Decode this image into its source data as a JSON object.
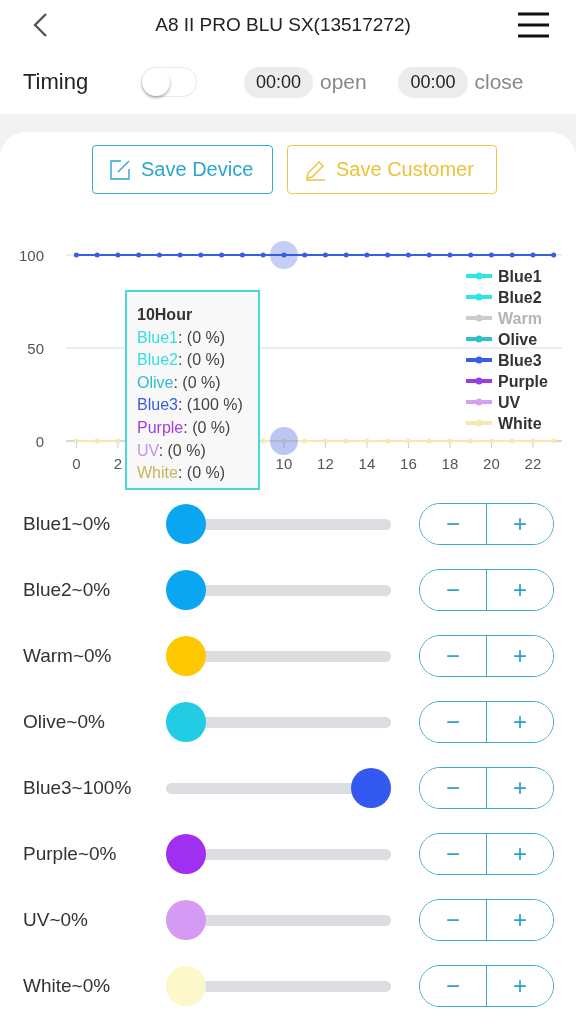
{
  "header": {
    "title": "A8 II PRO BLU SX(13517272)"
  },
  "timing": {
    "label": "Timing",
    "on": false,
    "open_time": "00:00",
    "open_label": "open",
    "close_time": "00:00",
    "close_label": "close"
  },
  "buttons": [
    {
      "kind": "device",
      "label": "Save Device"
    },
    {
      "kind": "customer",
      "label": "Save Customer"
    }
  ],
  "chart": {
    "chart_data": {
      "type": "line",
      "x": [
        0,
        1,
        2,
        3,
        4,
        5,
        6,
        7,
        8,
        9,
        10,
        11,
        12,
        13,
        14,
        15,
        16,
        17,
        18,
        19,
        20,
        21,
        22,
        23
      ],
      "xlim": [
        -0.5,
        23.4
      ],
      "xticks": [
        0,
        2,
        10,
        12,
        14,
        16,
        18,
        20,
        22
      ],
      "yticks": [
        0,
        50,
        100
      ],
      "ylim": [
        0,
        100
      ],
      "legend": "right",
      "series": [
        {
          "name": "Blue1",
          "color": "#2ee6e6",
          "values": [
            null,
            null,
            null,
            null,
            null,
            null,
            null,
            null,
            null,
            null,
            null,
            null,
            null,
            null,
            null,
            null,
            null,
            null,
            null,
            null,
            null,
            null,
            null,
            null
          ]
        },
        {
          "name": "Blue2",
          "color": "#2ee6e6",
          "values": [
            null,
            null,
            null,
            null,
            null,
            null,
            null,
            null,
            null,
            null,
            null,
            null,
            null,
            null,
            null,
            null,
            null,
            null,
            null,
            null,
            null,
            null,
            null,
            null
          ]
        },
        {
          "name": "Warm",
          "color": "#cccccc",
          "values": [
            null,
            null,
            null,
            null,
            null,
            null,
            null,
            null,
            null,
            null,
            null,
            null,
            null,
            null,
            null,
            null,
            null,
            null,
            null,
            null,
            null,
            null,
            null,
            null
          ]
        },
        {
          "name": "Olive",
          "color": "#2fc0d0",
          "values": [
            null,
            null,
            null,
            null,
            null,
            null,
            null,
            null,
            null,
            null,
            null,
            null,
            null,
            null,
            null,
            null,
            null,
            null,
            null,
            null,
            null,
            null,
            null,
            null
          ]
        },
        {
          "name": "Blue3",
          "color": "#3a5ee0",
          "values": [
            100,
            100,
            100,
            100,
            100,
            100,
            100,
            100,
            100,
            100,
            100,
            100,
            100,
            100,
            100,
            100,
            100,
            100,
            100,
            100,
            100,
            100,
            100,
            100
          ]
        },
        {
          "name": "Purple",
          "color": "#9b3ee0",
          "values": [
            null,
            null,
            null,
            null,
            null,
            null,
            null,
            null,
            null,
            null,
            null,
            null,
            null,
            null,
            null,
            null,
            null,
            null,
            null,
            null,
            null,
            null,
            null,
            null
          ]
        },
        {
          "name": "UV",
          "color": "#d4a0f0",
          "values": [
            null,
            null,
            null,
            null,
            null,
            null,
            null,
            null,
            null,
            null,
            null,
            null,
            null,
            null,
            null,
            null,
            null,
            null,
            null,
            null,
            null,
            null,
            null,
            null
          ]
        },
        {
          "name": "White",
          "color": "#f3e9b4",
          "values": [
            0,
            0,
            0,
            null,
            null,
            null,
            null,
            null,
            null,
            0,
            0,
            0,
            0,
            0,
            0,
            0,
            0,
            0,
            0,
            0,
            0,
            0,
            0,
            0
          ]
        }
      ]
    },
    "legend": [
      {
        "on": true
      },
      {
        "on": true
      },
      {
        "on": false
      },
      {
        "on": true
      },
      {
        "on": true
      },
      {
        "on": true
      },
      {
        "on": true
      },
      {
        "on": true
      }
    ],
    "tooltip": {
      "title": "10Hour",
      "entries": [
        {
          "name": "Blue1",
          "color": "#33dede",
          "value": ": (0 %)"
        },
        {
          "name": "Blue2",
          "color": "#33dede",
          "value": ": (0 %)"
        },
        {
          "name": "Olive",
          "color": "#30bccc",
          "value": ": (0 %)"
        },
        {
          "name": "Blue3",
          "color": "#3a5ed8",
          "value": ": (100 %)"
        },
        {
          "name": "Purple",
          "color": "#a040e0",
          "value": ": (0 %)"
        },
        {
          "name": "UV",
          "color": "#c690ec",
          "value": ": (0 %)"
        },
        {
          "name": "White",
          "color": "#c8b560",
          "value": ": (0 %)"
        }
      ]
    }
  },
  "channels": [
    {
      "label": "Blue1~0%",
      "level": 0,
      "color": "#0aa6f2",
      "minus": "−",
      "plus": "+"
    },
    {
      "label": "Blue2~0%",
      "level": 0,
      "color": "#0aa6f2",
      "minus": "−",
      "plus": "+"
    },
    {
      "label": "Warm~0%",
      "level": 0,
      "color": "#ffc800",
      "minus": "−",
      "plus": "+"
    },
    {
      "label": "Olive~0%",
      "level": 0,
      "color": "#22cce4",
      "minus": "−",
      "plus": "+"
    },
    {
      "label": "Blue3~100%",
      "level": 1,
      "color": "#3359f0",
      "minus": "−",
      "plus": "+"
    },
    {
      "label": "Purple~0%",
      "level": 0,
      "color": "#a030f0",
      "minus": "−",
      "plus": "+"
    },
    {
      "label": "UV~0%",
      "level": 0,
      "color": "#d49af4",
      "minus": "−",
      "plus": "+"
    },
    {
      "label": "White~0%",
      "level": 0,
      "color": "#fdf7cc",
      "minus": "−",
      "plus": "+"
    }
  ]
}
